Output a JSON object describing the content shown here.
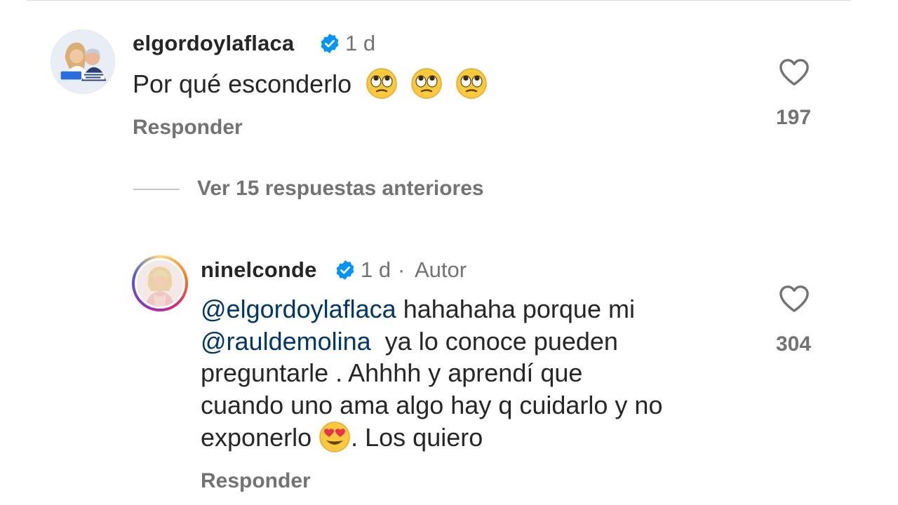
{
  "comment1": {
    "username": "elgordoylaflaca",
    "time": "1 d",
    "text": "Por qué esconderlo",
    "emojis": [
      "face-with-rolling-eyes",
      "face-with-rolling-eyes",
      "face-with-rolling-eyes"
    ],
    "reply_label": "Responder",
    "likes": "197",
    "avatar_icon": "tv-show-avatar"
  },
  "view_replies_label": "Ver 15 respuestas anteriores",
  "comment2": {
    "username": "ninelconde",
    "time": "1 d",
    "separator": "·",
    "author_badge": "Autor",
    "mention1": "@elgordoylaflaca",
    "line1_rest": " hahahaha porque mi",
    "mention2": "@rauldemolina",
    "line2_rest": "  ya lo conoce pueden",
    "line3": "preguntarle . Ahhhh y aprendí que",
    "line4": "cuando uno ama algo hay q cuidarlo y no",
    "line5_start": "exponerlo ",
    "line5_emoji": "smiling-face-with-heart-eyes",
    "line5_end": ". Los quiero",
    "reply_label": "Responder",
    "likes": "304",
    "avatar_icon": "profile-photo-avatar"
  },
  "colors": {
    "verified_blue": "#0095f6",
    "mention_blue": "#00376b",
    "secondary_gray": "#737373",
    "primary_text": "#262626"
  }
}
